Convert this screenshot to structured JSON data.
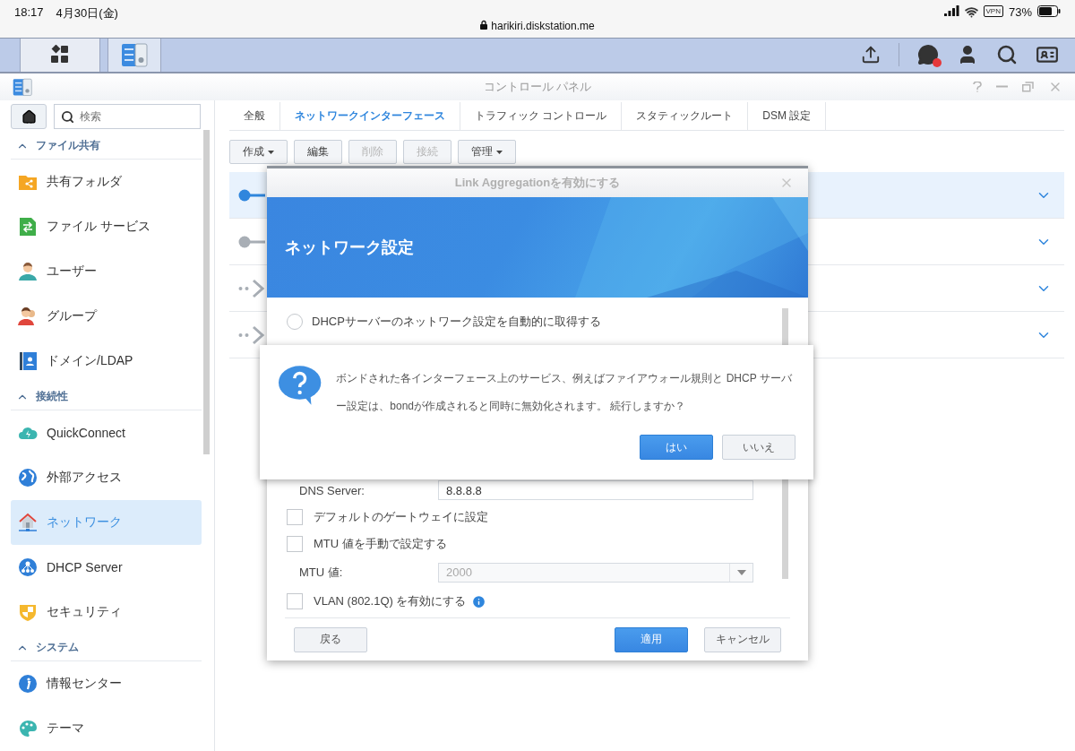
{
  "status_bar": {
    "time": "18:17",
    "date": "4月30日(金)",
    "url": "harikiri.diskstation.me",
    "vpn": "VPN",
    "battery": "73%"
  },
  "taskbar": {
    "apps": [
      {
        "kind": "menu",
        "selected": false
      },
      {
        "kind": "control-panel",
        "selected": true
      }
    ],
    "notification": true
  },
  "window": {
    "title": "コントロール パネル"
  },
  "sidebar": {
    "search": {
      "placeholder": "検索"
    },
    "sections": [
      {
        "title": "ファイル共有",
        "expanded": true,
        "items": [
          {
            "label": "共有フォルダ",
            "selected": false
          },
          {
            "label": "ファイル サービス",
            "selected": false
          },
          {
            "label": "ユーザー",
            "selected": false
          },
          {
            "label": "グループ",
            "selected": false
          },
          {
            "label": "ドメイン/LDAP",
            "selected": false
          }
        ]
      },
      {
        "title": "接続性",
        "expanded": true,
        "items": [
          {
            "label": "QuickConnect",
            "selected": false
          },
          {
            "label": "外部アクセス",
            "selected": false
          },
          {
            "label": "ネットワーク",
            "selected": true
          },
          {
            "label": "DHCP Server",
            "selected": false
          },
          {
            "label": "セキュリティ",
            "selected": false
          }
        ]
      },
      {
        "title": "システム",
        "expanded": true,
        "items": [
          {
            "label": "情報センター",
            "selected": false
          },
          {
            "label": "テーマ",
            "selected": false
          }
        ]
      }
    ]
  },
  "tabs": [
    {
      "label": "全般",
      "selected": false
    },
    {
      "label": "ネットワークインターフェース",
      "selected": true
    },
    {
      "label": "トラフィック コントロール",
      "selected": false
    },
    {
      "label": "スタティックルート",
      "selected": false
    },
    {
      "label": "DSM 設定",
      "selected": false
    }
  ],
  "toolbar": [
    {
      "label": "作成",
      "dropdown": true,
      "disabled": false
    },
    {
      "label": "編集",
      "dropdown": false,
      "disabled": false
    },
    {
      "label": "削除",
      "dropdown": false,
      "disabled": true
    },
    {
      "label": "接続",
      "dropdown": false,
      "disabled": true
    },
    {
      "label": "管理",
      "dropdown": true,
      "disabled": false
    }
  ],
  "interfaces": [
    {
      "kind": "connected",
      "selected": true
    },
    {
      "kind": "disconnected",
      "selected": false
    },
    {
      "kind": "vpn",
      "selected": false
    },
    {
      "kind": "vpn",
      "selected": false
    }
  ],
  "dialog": {
    "title": "Link Aggregationを有効にする",
    "banner": "ネットワーク設定",
    "radio": {
      "label": "DHCPサーバーのネットワーク設定を自動的に取得する",
      "selected": false
    },
    "dns": {
      "label": "DNS Server:",
      "value": "8.8.8.8"
    },
    "checks": [
      {
        "label": "デフォルトのゲートウェイに設定",
        "checked": false
      },
      {
        "label": "MTU 値を手動で設定する",
        "checked": false
      }
    ],
    "mtu": {
      "label": "MTU 値:",
      "value": "2000",
      "disabled": true
    },
    "vlan": {
      "label": "VLAN (802.1Q) を有効にする",
      "checked": false
    },
    "buttons": [
      {
        "label": "戻る",
        "primary": false
      },
      {
        "label": "適用",
        "primary": true
      },
      {
        "label": "キャンセル",
        "primary": false
      }
    ]
  },
  "confirm": {
    "message": "ボンドされた各インターフェース上のサービス、例えばファイアウォール規則と DHCP サーバー設定は、bondが作成されると同時に無効化されます。 続行しますか？",
    "buttons": [
      {
        "label": "はい",
        "primary": true
      },
      {
        "label": "いいえ",
        "primary": false
      }
    ]
  }
}
